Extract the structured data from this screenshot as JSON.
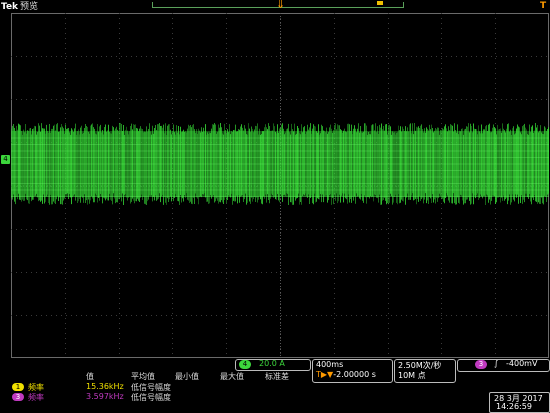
{
  "header": {
    "brand": "Tek",
    "mode": "预览"
  },
  "colors": {
    "trace": "#38e038",
    "ch4": "#3cd63c",
    "ch3": "#c03ac0",
    "ch1": "#f0e000",
    "trigger_marker": "#ff9a00"
  },
  "channel4": {
    "badge": "4",
    "scale": "20.0 A"
  },
  "timebase": {
    "scale": "400ms",
    "delay_icon": "T▶▼",
    "delay": "-2.00000 s"
  },
  "acquisition": {
    "sample_rate": "2.50M次/秒",
    "record_length": "10M 点"
  },
  "trigger": {
    "source_badge": "3",
    "slope": "∫",
    "level": "-400mV"
  },
  "measurements": {
    "headers": [
      "值",
      "平均值",
      "最小值",
      "最大值",
      "标准差"
    ],
    "rows": [
      {
        "badge": "1",
        "name": "频率",
        "value": "15.36kHz",
        "status": "低信号幅度",
        "color": "#f0e000"
      },
      {
        "badge": "3",
        "name": "频率",
        "value": "3.597kHz",
        "status": "低信号幅度",
        "color": "#c03ac0"
      }
    ]
  },
  "datetime": {
    "date": "28 3月  2017",
    "time": "14:26:59"
  },
  "ch4_ref_marker": "4"
}
